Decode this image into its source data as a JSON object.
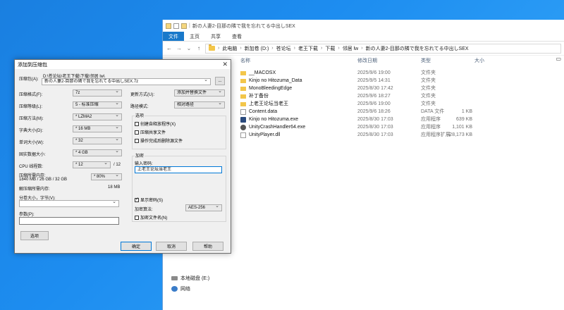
{
  "explorer": {
    "title": "新の人妻2-目那の隣で我を忘れてる中出しSEX",
    "ribbon_tabs": [
      "文件",
      "主页",
      "共享",
      "查看"
    ],
    "breadcrumb": [
      "此电脑",
      "新加卷 (D:)",
      "苍论坛",
      "老王下载",
      "下载",
      "邻居 lw",
      "新の人妻2-目那の隣で我を忘れてる中出しSEX"
    ],
    "columns": {
      "name": "名称",
      "date": "修改日期",
      "type": "类型",
      "size": "大小"
    },
    "files": [
      {
        "name": "__MACOSX",
        "date": "2025/9/6 19:00",
        "type": "文件夹",
        "size": "",
        "icon": "folder-icon"
      },
      {
        "name": "Kinjo no Hitozuma_Data",
        "date": "2025/9/5 14:31",
        "type": "文件夹",
        "size": "",
        "icon": "folder-icon"
      },
      {
        "name": "MonoBleedingEdge",
        "date": "2025/8/30 17:42",
        "type": "文件夹",
        "size": "",
        "icon": "folder-icon"
      },
      {
        "name": "补丁备份",
        "date": "2025/9/6 18:27",
        "type": "文件夹",
        "size": "",
        "icon": "folder-icon"
      },
      {
        "name": "上老王论坛当老王",
        "date": "2025/9/6 19:00",
        "type": "文件夹",
        "size": "",
        "icon": "folder-icon"
      },
      {
        "name": "Content.data",
        "date": "2025/9/6 18:26",
        "type": "DATA 文件",
        "size": "1 KB",
        "icon": "document-icon"
      },
      {
        "name": "Kinjo no Hitozuma.exe",
        "date": "2025/8/30 17:03",
        "type": "应用程序",
        "size": "639 KB",
        "icon": "app-icon"
      },
      {
        "name": "UnityCrashHandler64.exe",
        "date": "2025/8/30 17:03",
        "type": "应用程序",
        "size": "1,101 KB",
        "icon": "gear-icon"
      },
      {
        "name": "UnityPlayer.dll",
        "date": "2025/8/30 17:03",
        "type": "应用程序扩展",
        "size": "28,173 KB",
        "icon": "dll-icon"
      }
    ],
    "nav": {
      "drive_e": "本地磁盘 (E:)",
      "network": "网络"
    }
  },
  "dialog": {
    "title": "添加到压缩包",
    "archive_label": "压缩包(A):",
    "archive_path": "D:\\苍论坛\\老王下载\\下载\\邻居 lw\\",
    "archive_name": "新の人妻2-目那の隣で我を忘れてる中出しSEX.7z",
    "browse_label": "...",
    "left": {
      "format_label": "压缩格式(F):",
      "format_value": "7z",
      "level_label": "压缩等级(L):",
      "level_value": "5 - 标准压缩",
      "method_label": "压缩方法(M):",
      "method_value": "* LZMA2",
      "dict_label": "字典大小(D):",
      "dict_value": "* 16 MB",
      "word_label": "单词大小(W):",
      "word_value": "* 32",
      "solid_label": "固实数据大小:",
      "solid_value": "* 4 GB",
      "cpu_label": "CPU 线程数:",
      "cpu_value": "* 12",
      "cpu_total": "/ 12",
      "mem_label": "压缩所需内存:",
      "mem_detail": "1840 MB / 26 GB / 32 GB",
      "mem_value": "* 80%",
      "decomp_label": "解压缩所需内存:",
      "decomp_value": "18 MB",
      "split_label": "分卷大小，字节(V):",
      "params_label": "参数(P):",
      "options_button": "选项"
    },
    "right": {
      "update_label": "更新方式(U):",
      "update_value": "添加并替换文件",
      "path_label": "路径模式:",
      "path_value": "相对路径",
      "options_group": "选项",
      "opt_sfx": "创建自释放程序(X)",
      "opt_shared": "压缩共享文件",
      "opt_delete": "操作完成后删除源文件",
      "enc_group": "加密",
      "pwd_label": "输入密码:",
      "pwd_value": "上老王论坛当老王",
      "show_pwd": "显示密码(S)",
      "enc_method_label": "加密算法:",
      "enc_method_value": "AES-256",
      "enc_names": "加密文件名(N)"
    },
    "buttons": {
      "ok": "确定",
      "cancel": "取消",
      "help": "帮助"
    }
  }
}
